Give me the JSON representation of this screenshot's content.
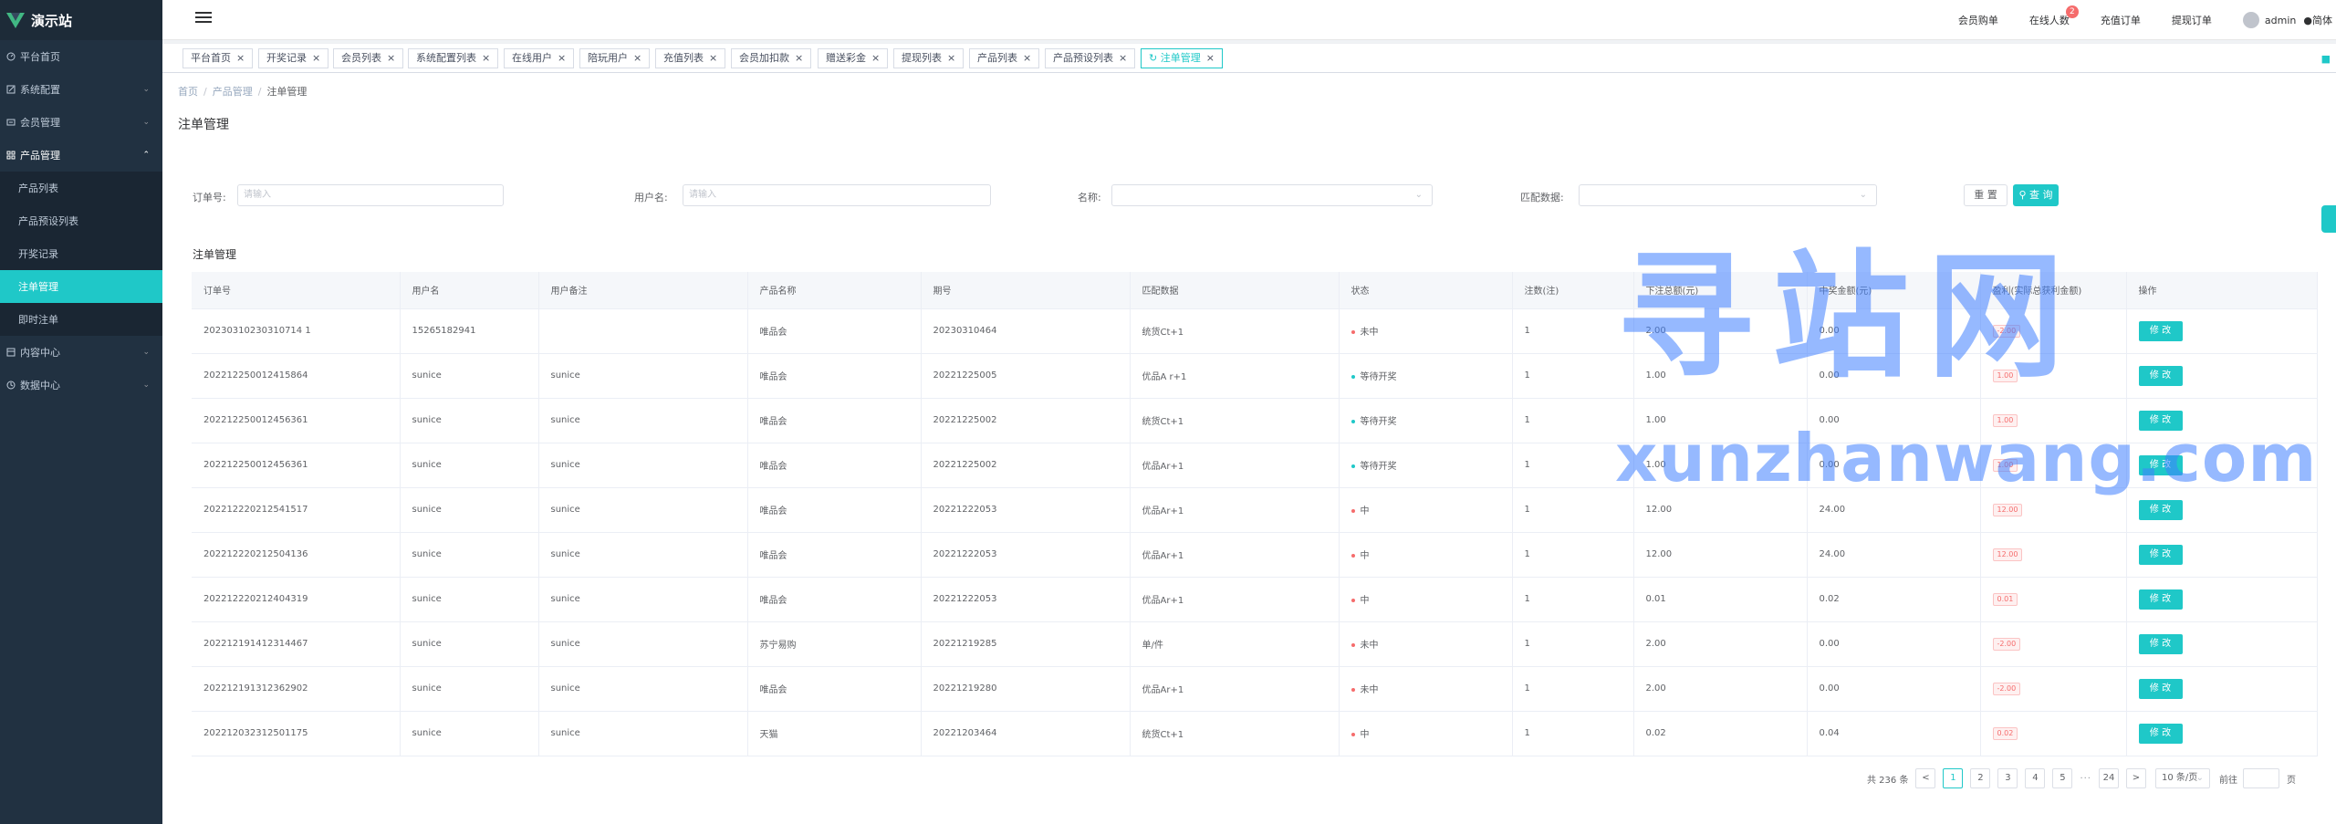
{
  "app": {
    "name": "演示站",
    "brand_color": "#1fc8c8",
    "sidebar_bg": "#213141"
  },
  "sidebar": {
    "items": [
      {
        "label": "平台首页",
        "icon": "dashboard-icon"
      },
      {
        "label": "系统配置",
        "icon": "edit-icon"
      },
      {
        "label": "会员管理",
        "icon": "user-icon"
      },
      {
        "label": "产品管理",
        "icon": "grid-icon",
        "open": true
      },
      {
        "label": "内容中心",
        "icon": "content-icon"
      },
      {
        "label": "数据中心",
        "icon": "clock-icon"
      }
    ],
    "sub_items": [
      {
        "label": "产品列表"
      },
      {
        "label": "产品预设列表"
      },
      {
        "label": "开奖记录"
      },
      {
        "label": "注单管理",
        "active": true
      },
      {
        "label": "即时注单"
      }
    ]
  },
  "header": {
    "links": [
      {
        "label": "会员购单"
      },
      {
        "label": "在线人数",
        "badge": "2"
      },
      {
        "label": "充值订单"
      },
      {
        "label": "提现订单"
      }
    ],
    "user": "admin",
    "lang": "简体"
  },
  "tags": [
    {
      "label": "平台首页"
    },
    {
      "label": "开奖记录"
    },
    {
      "label": "会员列表"
    },
    {
      "label": "系统配置列表"
    },
    {
      "label": "在线用户"
    },
    {
      "label": "陪玩用户"
    },
    {
      "label": "充值列表"
    },
    {
      "label": "会员加扣款"
    },
    {
      "label": "赠送彩金"
    },
    {
      "label": "提现列表"
    },
    {
      "label": "产品列表"
    },
    {
      "label": "产品预设列表"
    },
    {
      "label": "注单管理",
      "active": true
    }
  ],
  "breadcrumb": {
    "home": "首页",
    "parent": "产品管理",
    "current": "注单管理"
  },
  "page_title": "注单管理",
  "filters": {
    "order_label": "订单号:",
    "order_placeholder": "请输入",
    "user_label": "用户名:",
    "user_placeholder": "请输入",
    "name_label": "名称:",
    "match_label": "匹配数据:",
    "reset": "重 置",
    "search": "查 询"
  },
  "table": {
    "title": "注单管理",
    "columns": [
      "订单号",
      "用户名",
      "用户备注",
      "产品名称",
      "期号",
      "匹配数据",
      "状态",
      "注数(注)",
      "下注总额(元)",
      "中奖金额(元)",
      "盈利(实际总获利金额)",
      "操作"
    ],
    "edit_label": "修 改",
    "rows": [
      {
        "order": "20230310230310714 1",
        "user": "15265182941",
        "remark": "",
        "product": "唯品会",
        "period": "20230310464",
        "match": "统货Ct+1",
        "status": "未中",
        "status_color": "#f56c6c",
        "count": "1",
        "bet": "2.00",
        "win": "0.00",
        "profit": "-2.00"
      },
      {
        "order": "202212250012415864",
        "user": "sunice",
        "remark": "sunice",
        "product": "唯品会",
        "period": "20221225005",
        "match": "优品A r+1",
        "status": "等待开奖",
        "status_color": "#1fc8c8",
        "count": "1",
        "bet": "1.00",
        "win": "0.00",
        "profit": "1.00"
      },
      {
        "order": "202212250012456361",
        "user": "sunice",
        "remark": "sunice",
        "product": "唯品会",
        "period": "20221225002",
        "match": "统货Ct+1",
        "status": "等待开奖",
        "status_color": "#1fc8c8",
        "count": "1",
        "bet": "1.00",
        "win": "0.00",
        "profit": "1.00"
      },
      {
        "order": "202212250012456361",
        "user": "sunice",
        "remark": "sunice",
        "product": "唯品会",
        "period": "20221225002",
        "match": "优品Ar+1",
        "status": "等待开奖",
        "status_color": "#1fc8c8",
        "count": "1",
        "bet": "1.00",
        "win": "0.00",
        "profit": "1.00"
      },
      {
        "order": "202212220212541517",
        "user": "sunice",
        "remark": "sunice",
        "product": "唯品会",
        "period": "20221222053",
        "match": "优品Ar+1",
        "status": "中",
        "status_color": "#f56c6c",
        "count": "1",
        "bet": "12.00",
        "win": "24.00",
        "profit": "12.00"
      },
      {
        "order": "202212220212504136",
        "user": "sunice",
        "remark": "sunice",
        "product": "唯品会",
        "period": "20221222053",
        "match": "优品Ar+1",
        "status": "中",
        "status_color": "#f56c6c",
        "count": "1",
        "bet": "12.00",
        "win": "24.00",
        "profit": "12.00"
      },
      {
        "order": "202212220212404319",
        "user": "sunice",
        "remark": "sunice",
        "product": "唯品会",
        "period": "20221222053",
        "match": "优品Ar+1",
        "status": "中",
        "status_color": "#f56c6c",
        "count": "1",
        "bet": "0.01",
        "win": "0.02",
        "profit": "0.01"
      },
      {
        "order": "202212191412314467",
        "user": "sunice",
        "remark": "sunice",
        "product": "苏宁易购",
        "period": "20221219285",
        "match": "单/件",
        "status": "未中",
        "status_color": "#f56c6c",
        "count": "1",
        "bet": "2.00",
        "win": "0.00",
        "profit": "-2.00"
      },
      {
        "order": "202212191312362902",
        "user": "sunice",
        "remark": "sunice",
        "product": "唯品会",
        "period": "20221219280",
        "match": "优品Ar+1",
        "status": "未中",
        "status_color": "#f56c6c",
        "count": "1",
        "bet": "2.00",
        "win": "0.00",
        "profit": "-2.00"
      },
      {
        "order": "202212032312501175",
        "user": "sunice",
        "remark": "sunice",
        "product": "天猫",
        "period": "20221203464",
        "match": "统货Ct+1",
        "status": "中",
        "status_color": "#f56c6c",
        "count": "1",
        "bet": "0.02",
        "win": "0.04",
        "profit": "0.02"
      }
    ]
  },
  "pagination": {
    "total": "共 236 条",
    "prev": "<",
    "pages": [
      "1",
      "2",
      "3",
      "4",
      "5"
    ],
    "ellipsis": "···",
    "last": "24",
    "next": ">",
    "page_size": "10 条/页",
    "jump_label": "前往",
    "jump_suffix": "页"
  },
  "watermark": {
    "cn": "寻站网",
    "en": "xunzhanwang.com"
  }
}
